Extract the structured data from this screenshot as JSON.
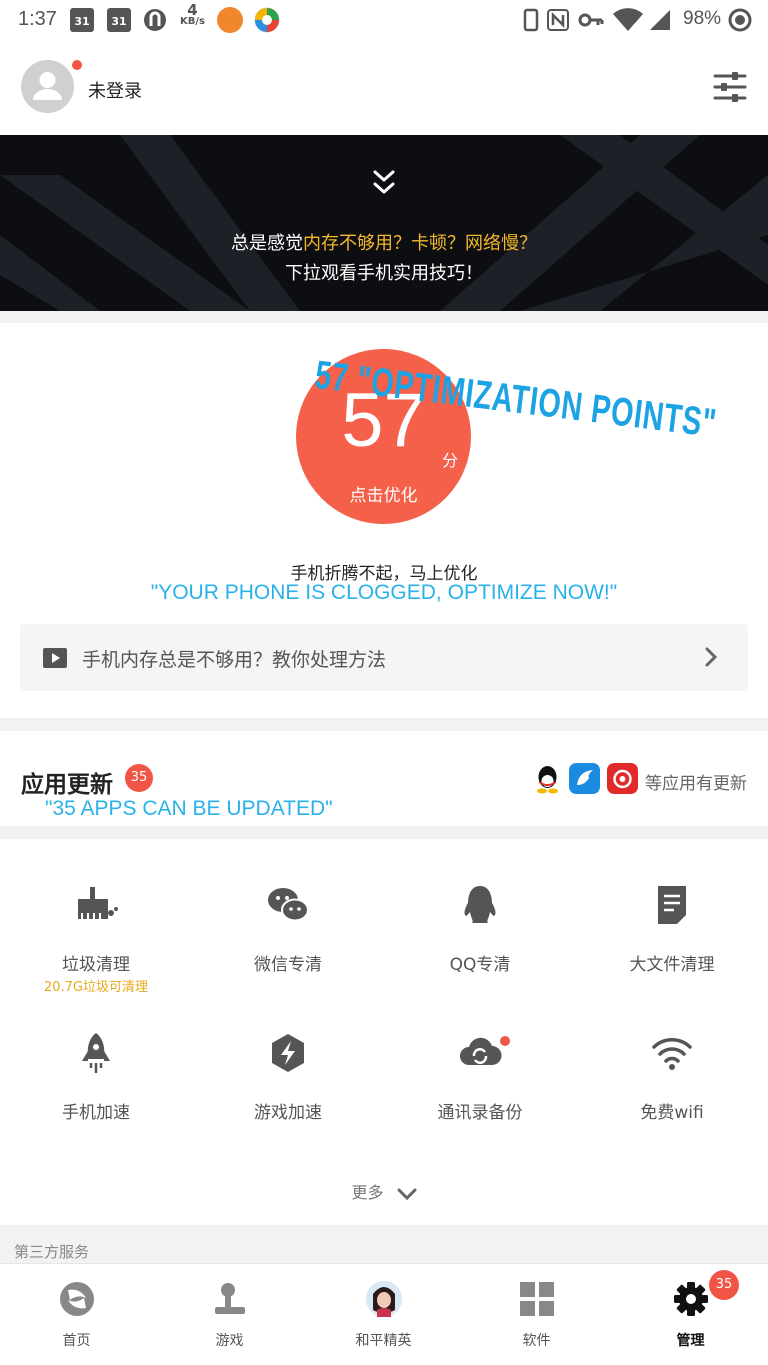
{
  "status_bar": {
    "time": "1:37",
    "calendar_day_1": "31",
    "calendar_day_2": "31",
    "net_speed_value": "4",
    "net_speed_unit": "KB/s",
    "battery": "98%"
  },
  "header": {
    "login_status": "未登录"
  },
  "banner": {
    "line1_prefix": "总是感觉",
    "line1_highlight": "内存不够用？卡顿？网络慢？",
    "line2": "下拉观看手机实用技巧！"
  },
  "score": {
    "value": "57",
    "unit": "分",
    "action": "点击优化",
    "tip": "手机折腾不起，马上优化",
    "annotation_points": "57 \"OPTIMIZATION POINTS\"",
    "annotation_clogged": "\"YOUR PHONE IS CLOGGED, OPTIMIZE NOW!\"",
    "video_tip": "手机内存总是不够用？教你处理方法"
  },
  "app_update": {
    "title": "应用更新",
    "count": "35",
    "annotation": "\"35 APPS CAN BE UPDATED\"",
    "more_text": "等应用有更新",
    "app_icons": [
      "qq-icon",
      "bird-app-icon",
      "netease-music-icon"
    ]
  },
  "tools": [
    {
      "label": "垃圾清理",
      "sub": "20.7G垃圾可清理",
      "icon": "broom-icon"
    },
    {
      "label": "微信专清",
      "icon": "wechat-icon"
    },
    {
      "label": "QQ专清",
      "icon": "qq-penguin-icon"
    },
    {
      "label": "大文件清理",
      "icon": "document-icon"
    },
    {
      "label": "手机加速",
      "icon": "rocket-icon"
    },
    {
      "label": "游戏加速",
      "icon": "game-boost-icon"
    },
    {
      "label": "通讯录备份",
      "icon": "cloud-sync-icon"
    },
    {
      "label": "免费wifi",
      "icon": "wifi-icon"
    }
  ],
  "more_label": "更多",
  "third_party_label": "第三方服务",
  "tabbar": {
    "items": [
      {
        "label": "首页",
        "icon": "home-logo-icon"
      },
      {
        "label": "游戏",
        "icon": "joystick-icon"
      },
      {
        "label": "和平精英",
        "icon": "game-avatar-icon"
      },
      {
        "label": "软件",
        "icon": "grid-apps-icon"
      },
      {
        "label": "管理",
        "icon": "gear-icon",
        "badge": "35"
      }
    ]
  },
  "colors": {
    "accent_red": "#f4604a",
    "badge_red": "#f05545",
    "highlight_yellow": "#f5b72b",
    "annotation_blue": "#29b2ea"
  }
}
